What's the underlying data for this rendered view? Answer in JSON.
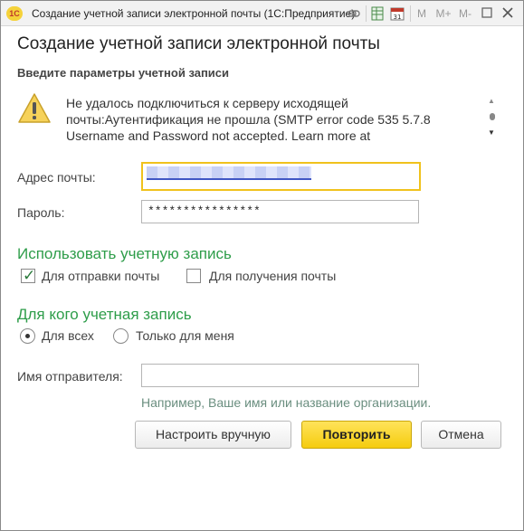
{
  "window": {
    "title": "Создание учетной записи электронной почты  (1С:Предприятие)",
    "app_logo_text": "1С",
    "toolbar": {
      "m": "M",
      "m_plus": "M+",
      "m_minus": "M-"
    }
  },
  "dialog": {
    "title": "Создание учетной записи электронной почты",
    "subtitle": "Введите параметры учетной записи",
    "error_message": "Не удалось подключиться к серверу исходящей почты:Аутентификация не прошла (SMTP error code 535 5.7.8 Username and Password not accepted. Learn more at"
  },
  "form": {
    "email_label": "Адрес почты:",
    "email_value": "",
    "password_label": "Пароль:",
    "password_value": "****************",
    "use_account_title": "Использовать учетную запись",
    "for_sending_label": "Для отправки почты",
    "for_sending_checked": true,
    "for_receiving_label": "Для получения почты",
    "for_receiving_checked": false,
    "for_whom_title": "Для кого учетная запись",
    "for_all_label": "Для всех",
    "only_me_label": "Только для меня",
    "selected_audience": "Для всех",
    "sender_name_label": "Имя отправителя:",
    "sender_name_value": "",
    "sender_hint": "Например, Ваше имя или название организации."
  },
  "buttons": {
    "manual": "Настроить вручную",
    "retry": "Повторить",
    "cancel": "Отмена"
  },
  "colors": {
    "accent_green": "#2e9d4a",
    "primary_button": "#f5cc0e",
    "focus_border": "#f0c21c"
  }
}
